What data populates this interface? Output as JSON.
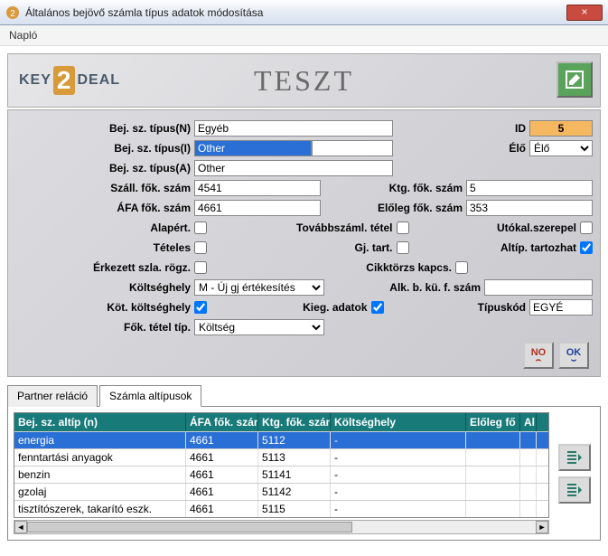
{
  "window": {
    "title": "Általános bejövő számla típus adatok módosítása",
    "close": "×"
  },
  "menu": {
    "naplo": "Napló"
  },
  "header": {
    "logo_key": "KEY",
    "logo_2": "2",
    "logo_deal": "DEAL",
    "teszt": "TESZT"
  },
  "form": {
    "labels": {
      "bej_n": "Bej. sz. típus(N)",
      "bej_i": "Bej. sz. típus(I)",
      "bej_a": "Bej. sz. típus(A)",
      "szall": "Száll. fők. szám",
      "afa": "ÁFA fők. szám",
      "alap": "Alapért.",
      "teteles": "Tételes",
      "erkezett": "Érkezett szla. rögz.",
      "koltseghely": "Költséghely",
      "kot_kolt": "Köt. költséghely",
      "fok_tetel": "Fők. tétel típ.",
      "id": "ID",
      "elo": "Élő",
      "ktg": "Ktg. fők. szám",
      "eloleg": "Előleg fők. szám",
      "tovabb": "Továbbszáml. tétel",
      "gjtart": "Gj. tart.",
      "cikk": "Cikktörzs kapcs.",
      "alkbku": "Alk. b. kü. f. szám",
      "kieg": "Kieg. adatok",
      "utokal": "Utókal.szerepel",
      "altip": "Altíp. tartozhat",
      "tipuskod": "Típuskód"
    },
    "values": {
      "bej_n": "Egyéb",
      "bej_i": "Other",
      "bej_a": "Other",
      "szall": "4541",
      "afa": "4661",
      "id": "5",
      "elo": "Élő",
      "ktg": "5",
      "eloleg": "353",
      "koltseghely": "M - Új gj értékesítés",
      "fok_tetel": "Költség",
      "alkbku": "",
      "tipuskod": "EGYÉ"
    }
  },
  "buttons": {
    "no": "NO",
    "ok": "OK"
  },
  "tabs": {
    "t1": "Partner reláció",
    "t2": "Számla altípusok"
  },
  "grid": {
    "headers": {
      "c1": "Bej. sz. altíp (n)",
      "c2": "ÁFA fők. szán",
      "c3": "Ktg. fők. szán",
      "c4": "Költséghely",
      "c5": "Előleg fő",
      "c6": "Al"
    },
    "rows": [
      {
        "c1": "energia",
        "c2": "4661",
        "c3": "5112",
        "c4": "-",
        "c5": "",
        "c6": ""
      },
      {
        "c1": "fenntartási anyagok",
        "c2": "4661",
        "c3": "5113",
        "c4": "-",
        "c5": "",
        "c6": ""
      },
      {
        "c1": "benzin",
        "c2": "4661",
        "c3": "51141",
        "c4": "-",
        "c5": "",
        "c6": ""
      },
      {
        "c1": "gzolaj",
        "c2": "4661",
        "c3": "51142",
        "c4": "-",
        "c5": "",
        "c6": ""
      },
      {
        "c1": "tisztítószerek, takarító eszk.",
        "c2": "4661",
        "c3": "5115",
        "c4": "-",
        "c5": "",
        "c6": ""
      }
    ]
  }
}
